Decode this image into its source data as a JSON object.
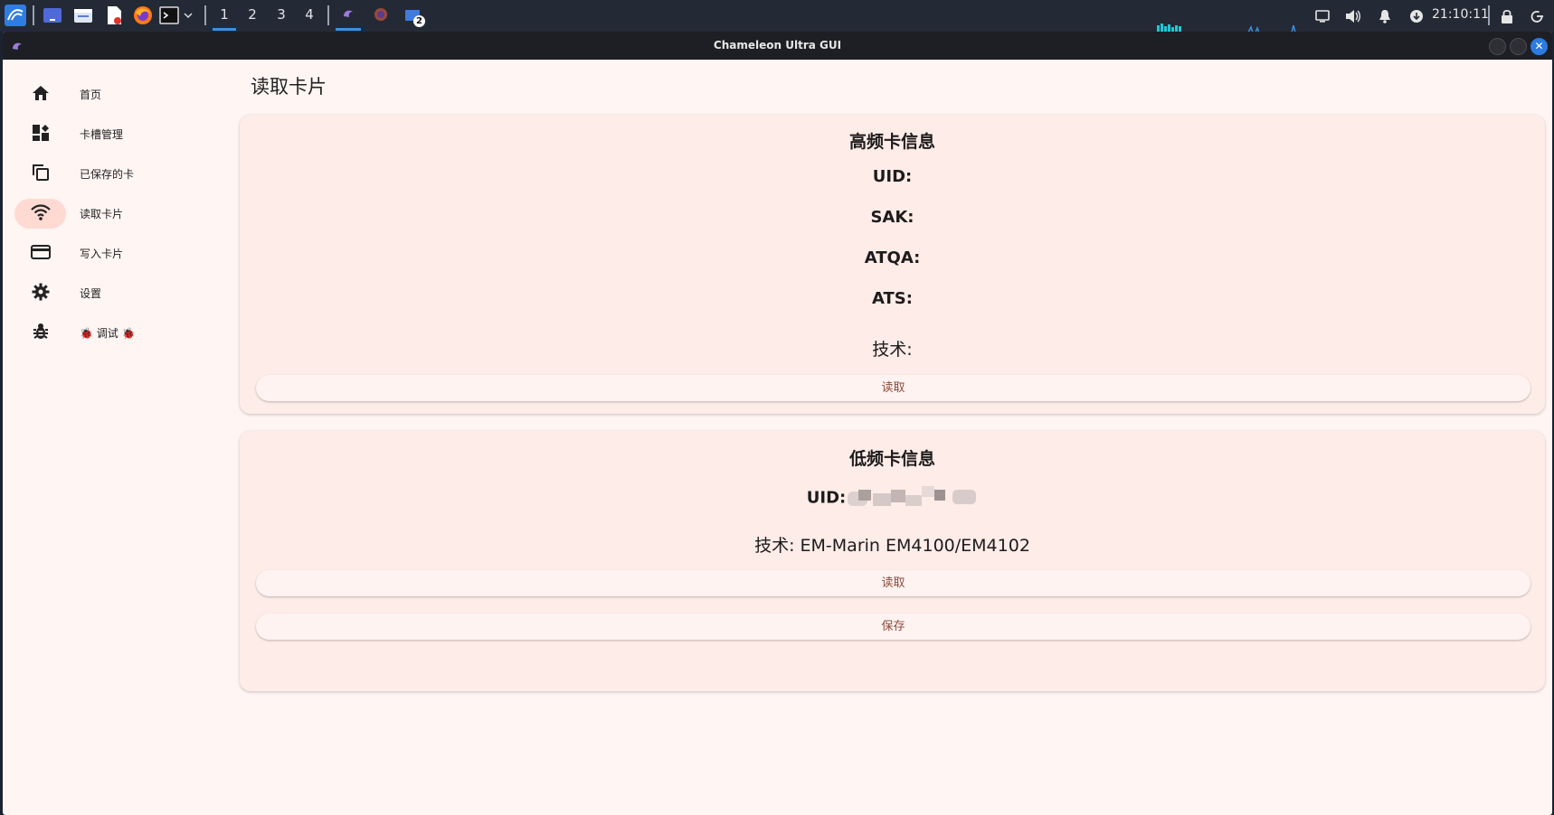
{
  "taskbar": {
    "workspaces": [
      "1",
      "2",
      "3",
      "4"
    ],
    "active_workspace": "1",
    "clock": "21:10:11",
    "notification_badge": "2"
  },
  "window": {
    "title": "Chameleon Ultra GUI"
  },
  "sidebar": {
    "items": [
      {
        "label": "首页",
        "icon": "home-icon"
      },
      {
        "label": "卡槽管理",
        "icon": "dashboard-icon"
      },
      {
        "label": "已保存的卡",
        "icon": "copy-icon"
      },
      {
        "label": "读取卡片",
        "icon": "wifi-icon",
        "selected": true
      },
      {
        "label": "写入卡片",
        "icon": "credit-card-icon"
      },
      {
        "label": "设置",
        "icon": "gear-icon"
      },
      {
        "label": "🐞 调试 🐞",
        "icon": "bug-icon"
      }
    ]
  },
  "main": {
    "title": "读取卡片",
    "hf_card": {
      "title": "高频卡信息",
      "uid_label": "UID:",
      "sak_label": "SAK:",
      "atqa_label": "ATQA:",
      "ats_label": "ATS:",
      "tech_label": "技术:",
      "read_button": "读取"
    },
    "lf_card": {
      "title": "低频卡信息",
      "uid_label": "UID:",
      "tech_text": "技术: EM-Marin EM4100/EM4102",
      "read_button": "读取",
      "save_button": "保存"
    }
  },
  "colors": {
    "accent": "#8c4a3b",
    "selected_nav": "#ffdad3",
    "card_bg": "#fdece8",
    "window_bg": "#fff5f3"
  }
}
